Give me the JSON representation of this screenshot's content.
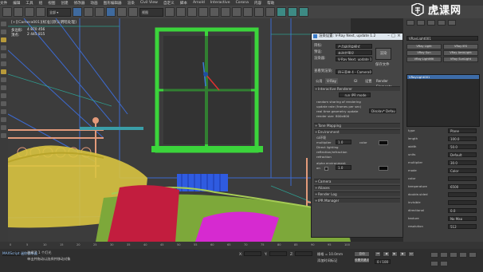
{
  "menubar": {
    "items": [
      "文件",
      "编辑",
      "工具",
      "组",
      "视图",
      "创建",
      "修改器",
      "动画",
      "图形编辑器",
      "渲染",
      "Civil View",
      "自定义",
      "脚本",
      "Arnold",
      "Interactive",
      "Corona",
      "内容",
      "帮助"
    ]
  },
  "toolbar": {
    "view_dropdown": "视图"
  },
  "viewport": {
    "label": "[+][Camera001][标准][默认明暗处理]",
    "stats": {
      "polys_label": "多边形:",
      "polys_value": "4 870 456",
      "verts_label": "顶点:",
      "verts_value": "2 445 815"
    }
  },
  "render_dialog": {
    "title": "渲染设置: V-Ray Next, update 1.2",
    "target_label": "目标:",
    "target_value": "产品级渲染模式",
    "preset_label": "预设:",
    "preset_value": "未选定预设",
    "renderer_label": "渲染器:",
    "renderer_value": "V-Ray Next, update 1.2",
    "view_label": "查看到渲染:",
    "view_value": "四元菜单 4 - Camera001",
    "render_button": "渲染",
    "save_file_label": "保存文件",
    "tabs": [
      "公用",
      "V-Ray",
      "GI",
      "设置",
      "Render Elements"
    ],
    "active_tab": "V-Ray",
    "rollouts": {
      "interactive": "Interactive Renderer",
      "tone": "Tone Mapping",
      "environment": "Environment",
      "camera": "Camera",
      "aliases": "Aliases",
      "render_log": "Render Log",
      "ipr": "IPR Manager"
    },
    "interactive_params": {
      "button": "run IPR mode",
      "p1": "random sharing of rendering",
      "p2": "update rate (frames per sec)",
      "p3": "real time geometry update",
      "p3_value": "Display* Default",
      "p4": "render size",
      "p4_value": "800x600"
    },
    "env_params": {
      "gi_label": "GI环境",
      "multiplier_label": "multiplier",
      "multiplier_value": "1.0",
      "color_label": "color",
      "direct_label": "Direct lighting",
      "reflection_label": "reflection/refraction",
      "refraction_label": "refraction",
      "alpha_label": "alpha environment",
      "on_label": "on",
      "multiplier2_value": "1.0"
    },
    "colors": {
      "header": "#dfe7ee",
      "body": "#454545",
      "field": "#2c2c2c"
    }
  },
  "command_panel": {
    "title": "VRayLight001",
    "buttons": [
      "VRay Light",
      "VRay IES",
      "VRay Sun",
      "VRay AmbLight",
      "VRay LightMtl",
      "VRay SunLight"
    ],
    "selected_item": "VRayLight001",
    "params": [
      {
        "label": "type",
        "value": "Plane"
      },
      {
        "label": "length",
        "value": "100.0"
      },
      {
        "label": "width",
        "value": "50.0"
      },
      {
        "label": "units",
        "value": "Default"
      },
      {
        "label": "multiplier",
        "value": "30.0"
      },
      {
        "label": "mode",
        "value": "Color"
      },
      {
        "label": "color",
        "value": ""
      },
      {
        "label": "temperature",
        "value": "6500"
      },
      {
        "label": "double-sided",
        "value": ""
      },
      {
        "label": "invisible",
        "value": ""
      },
      {
        "label": "directional",
        "value": "0.0"
      },
      {
        "label": "texture",
        "value": "No Map"
      },
      {
        "label": "resolution",
        "value": "512"
      }
    ]
  },
  "status": {
    "selected": "选择了 1 个灯光",
    "prompt": "单击并拖动以选择并移动对象",
    "script_label": "MAXScript 迷你侦听器",
    "x_label": "X:",
    "y_label": "Y:",
    "z_label": "Z:",
    "grid": "栅格 = 10.0mm",
    "add_time_tag": "添加时间标记",
    "auto_key": "自动",
    "set_key": "设置关键点",
    "frame": "0 / 100"
  },
  "timeline_ticks": [
    "0",
    "5",
    "10",
    "15",
    "20",
    "25",
    "30",
    "35",
    "40",
    "45",
    "50",
    "55",
    "60",
    "65",
    "70",
    "75",
    "80",
    "85",
    "90",
    "95",
    "100"
  ],
  "watermark": {
    "brand": "虎课网",
    "url": "huke88.com"
  }
}
